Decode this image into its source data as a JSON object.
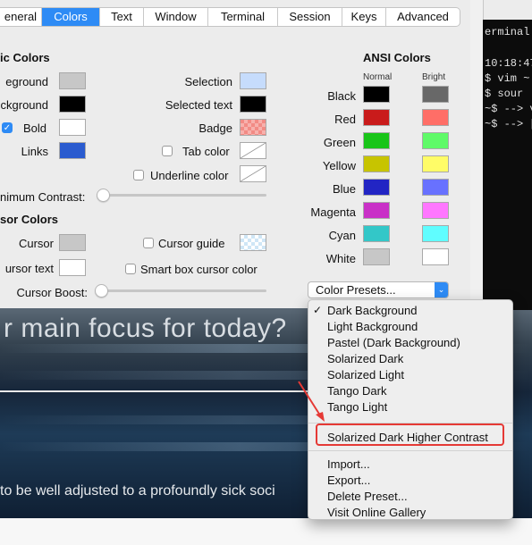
{
  "tabs": [
    "eneral",
    "Colors",
    "Text",
    "Window",
    "Terminal",
    "Session",
    "Keys",
    "Advanced"
  ],
  "active_tab": "Colors",
  "basic": {
    "title": "ic Colors",
    "foreground_label": "eground",
    "background_label": "ckground",
    "bold_label": "Bold",
    "links_label": "Links",
    "selection_label": "Selection",
    "selected_text_label": "Selected text",
    "badge_label": "Badge",
    "tab_color_label": "Tab color",
    "underline_color_label": "Underline color",
    "min_contrast_label": "nimum Contrast:",
    "colors": {
      "foreground": "#c7c7c7",
      "background": "#000000",
      "bold": "#ffffff",
      "links": "#2a5bcf",
      "selection": "#c6dcfc",
      "selected_text": "#000000"
    }
  },
  "cursor": {
    "title": "sor Colors",
    "cursor_label": "Cursor",
    "cursor_text_label": "ursor text",
    "cursor_guide_label": "Cursor guide",
    "smart_box_label": "Smart box cursor color",
    "boost_label": "Cursor Boost:",
    "colors": {
      "cursor": "#c7c7c7",
      "cursor_text": "#ffffff"
    }
  },
  "ansi": {
    "title": "ANSI Colors",
    "normal_label": "Normal",
    "bright_label": "Bright",
    "rows": [
      {
        "name": "Black",
        "normal": "#000000",
        "bright": "#686868"
      },
      {
        "name": "Red",
        "normal": "#c91b1b",
        "bright": "#ff6e67"
      },
      {
        "name": "Green",
        "normal": "#19c519",
        "bright": "#5ffa68"
      },
      {
        "name": "Yellow",
        "normal": "#c7c400",
        "bright": "#fffc67"
      },
      {
        "name": "Blue",
        "normal": "#2225c4",
        "bright": "#6871ff"
      },
      {
        "name": "Magenta",
        "normal": "#c930c7",
        "bright": "#ff77ff"
      },
      {
        "name": "Cyan",
        "normal": "#33c7c8",
        "bright": "#60fdff"
      },
      {
        "name": "White",
        "normal": "#c7c7c7",
        "bright": "#ffffff"
      }
    ]
  },
  "presets_button": "Color Presets...",
  "menu": {
    "checked_item": "Dark Background",
    "group1": [
      "Dark Background",
      "Light Background",
      "Pastel (Dark Background)",
      "Solarized Dark",
      "Solarized Light",
      "Tango Dark",
      "Tango Light"
    ],
    "group2": [
      "Solarized Dark Higher Contrast"
    ],
    "group3": [
      "Import...",
      "Export...",
      "Delete Preset...",
      "Visit Online Gallery"
    ]
  },
  "background_page": {
    "focus_question": "r main focus for today?",
    "quote": "to be well adjusted to a profoundly sick soci"
  },
  "terminal": {
    "lines": [
      "erminal b",
      "",
      "10:18:47",
      "$ vim ~",
      "$ sour",
      "~$ --> v",
      "~$ --> ["
    ]
  },
  "accent": "#2e8bf5",
  "annotation_color": "#e53935"
}
